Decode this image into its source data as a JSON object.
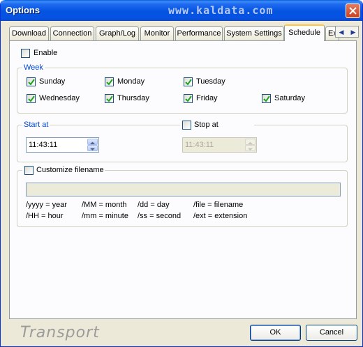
{
  "window": {
    "title": "Options",
    "watermark": "www.kaldata.com"
  },
  "tabs": [
    {
      "label": "Download"
    },
    {
      "label": "Connection"
    },
    {
      "label": "Graph/Log"
    },
    {
      "label": "Monitor"
    },
    {
      "label": "Performance"
    },
    {
      "label": "System Settings"
    },
    {
      "label": "Schedule",
      "active": true
    },
    {
      "label": "Ex"
    }
  ],
  "schedule": {
    "enable_label": "Enable",
    "enable_checked": false,
    "week": {
      "title": "Week",
      "days": [
        {
          "label": "Sunday",
          "checked": true
        },
        {
          "label": "Monday",
          "checked": true
        },
        {
          "label": "Tuesday",
          "checked": true
        },
        {
          "label": "Wednesday",
          "checked": true
        },
        {
          "label": "Thursday",
          "checked": true
        },
        {
          "label": "Friday",
          "checked": true
        },
        {
          "label": "Saturday",
          "checked": true
        }
      ]
    },
    "start": {
      "title": "Start at",
      "time": "11:43:11"
    },
    "stop": {
      "label": "Stop at",
      "checked": false,
      "time": "11:43:11"
    },
    "filename": {
      "label": "Customize filename",
      "checked": false,
      "value": "",
      "legend": [
        "/yyyy = year",
        "/MM = month",
        "/dd = day",
        "/file = filename",
        "/HH = hour",
        "/mm = minute",
        "/ss = second",
        "/ext = extension"
      ]
    }
  },
  "footer": {
    "label": "Transport",
    "ok": "OK",
    "cancel": "Cancel"
  }
}
